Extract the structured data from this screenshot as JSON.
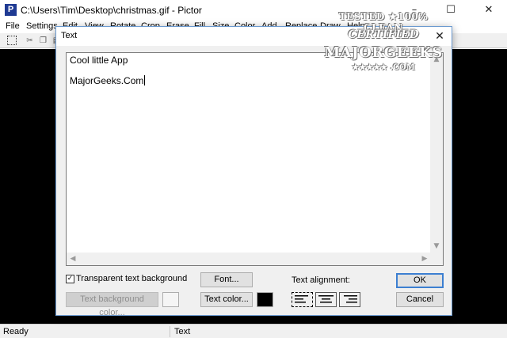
{
  "window": {
    "icon_letter": "P",
    "title": "C:\\Users\\Tim\\Desktop\\christmas.gif - Pictor",
    "minimize": "–",
    "maximize": "☐",
    "close": "✕"
  },
  "menu": {
    "items": [
      "File",
      "Settings",
      "Edit",
      "View",
      "Rotate",
      "Crop",
      "Erase",
      "Fill",
      "Size",
      "Color",
      "Add",
      "Replace",
      "Draw",
      "Help"
    ]
  },
  "toolbar": {
    "icons": [
      "select-icon",
      "cut-icon",
      "copy-icon",
      "paste-icon"
    ]
  },
  "watermark": {
    "line1": "TESTED ★100% CLEAN",
    "line2": "CERTIFIED",
    "line3": "MAJORGEEKS",
    "line4": "★★★★★ .COM"
  },
  "dialog": {
    "title": "Text",
    "close": "✕",
    "text_lines": [
      "Cool little App",
      "MajorGeeks.Com"
    ],
    "transparent_checkbox": {
      "label": "Transparent text background",
      "checked": true,
      "mark": "✓"
    },
    "bg_color_button": "Text background color...",
    "font_button": "Font...",
    "text_color_button": "Text color...",
    "text_color": "#000000",
    "bg_color": "#f5f5f5",
    "alignment_label": "Text alignment:",
    "alignment_selected": "left",
    "ok_button": "OK",
    "cancel_button": "Cancel"
  },
  "status": {
    "left": "Ready",
    "right": "Text"
  }
}
